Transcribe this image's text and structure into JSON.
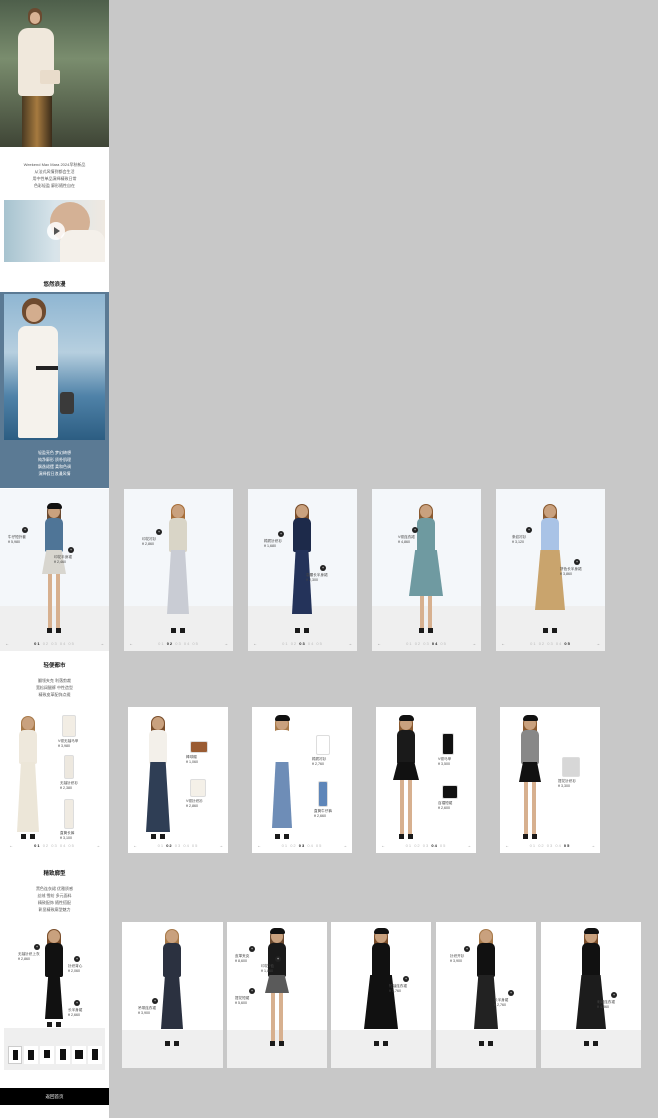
{
  "intro_lines": [
    "Weekend Max Mara 2024早秋新品",
    "从法式风情到都会生活",
    "用中性单品演绎精致日常",
    "色彩轻盈 廓形随性自在"
  ],
  "section1": {
    "title": "悠然浪漫",
    "lines": [
      "轻盈亮色 梦幻绮想",
      "纯净廓形 质朴肌理",
      "飘逸裙摆 柔和色调",
      "演绎假日浪漫风情"
    ]
  },
  "section2": {
    "title": "轻便都市",
    "lines": [
      "翻领夹克 利落剪裁",
      "宽松阔腿裤 中性造型",
      "精致皮革配饰点缀",
      "打造城市生活新风格"
    ]
  },
  "section3": {
    "title": "精致廓型",
    "lines": [
      "黑色连衣裙 优雅质感",
      "丝绒 雪纺 多元面料",
      "精致配饰 随性搭配",
      "彰显精致廓型魅力"
    ]
  },
  "bottom_button": "返回首页",
  "carousel1": [
    {
      "labels": [
        {
          "name": "牛仔短外套",
          "price": "¥ 5,980"
        },
        {
          "name": "印花半身裙",
          "price": "¥ 2,460"
        }
      ],
      "pager": [
        "01",
        "02",
        "03",
        "04",
        "05"
      ],
      "active": 0
    },
    {
      "labels": [
        {
          "name": "印花衬衫",
          "price": "¥ 2,860"
        }
      ],
      "pager": [
        "01",
        "02",
        "03",
        "04",
        "05"
      ],
      "active": 1
    },
    {
      "labels": [
        {
          "name": "棉质针织衫",
          "price": "¥ 1,680"
        },
        {
          "name": "高腰长半身裙",
          "price": "¥ 2,300"
        }
      ],
      "pager": [
        "01",
        "02",
        "03",
        "04",
        "05"
      ],
      "active": 2
    },
    {
      "labels": [
        {
          "name": "V领连衣裙",
          "price": "¥ 4,860"
        }
      ],
      "pager": [
        "01",
        "02",
        "03",
        "04",
        "05"
      ],
      "active": 3
    },
    {
      "labels": [
        {
          "name": "条纹衬衫",
          "price": "¥ 3,120"
        },
        {
          "name": "拼色长半身裙",
          "price": "¥ 3,860"
        }
      ],
      "pager": [
        "01",
        "02",
        "03",
        "04",
        "05"
      ],
      "active": 4
    }
  ],
  "carousel2": [
    {
      "items": [
        {
          "name": "V领无袖马甲",
          "price": "¥ 3,980"
        },
        {
          "name": "无袖针织衫",
          "price": "¥ 2,380"
        },
        {
          "name": "直筒长裤",
          "price": "¥ 3,100"
        }
      ],
      "pager": [
        "01",
        "02",
        "03",
        "04",
        "05"
      ],
      "active": 0
    },
    {
      "items": [
        {
          "name": "棒球帽",
          "price": "¥ 1,060"
        },
        {
          "name": "V领针织衫",
          "price": "¥ 2,860"
        }
      ],
      "pager": [
        "01",
        "02",
        "03",
        "04",
        "05"
      ],
      "active": 1
    },
    {
      "items": [
        {
          "name": "棉质衬衫",
          "price": "¥ 2,760"
        },
        {
          "name": "直筒牛仔裤",
          "price": "¥ 2,660"
        }
      ],
      "pager": [
        "01",
        "02",
        "03",
        "04",
        "05"
      ],
      "active": 2
    },
    {
      "items": [
        {
          "name": "V领马甲",
          "price": "¥ 3,500"
        },
        {
          "name": "百褶短裙",
          "price": "¥ 2,600"
        }
      ],
      "pager": [
        "01",
        "02",
        "03",
        "04",
        "05"
      ],
      "active": 3
    },
    {
      "items": [
        {
          "name": "提花针织衫",
          "price": "¥ 3,300"
        }
      ],
      "pager": [
        "01",
        "02",
        "03",
        "04",
        "05"
      ],
      "active": 4
    }
  ],
  "section3_card": {
    "labels": [
      {
        "name": "无袖针织上衣",
        "price": "¥ 2,860"
      },
      {
        "name": "针织背心",
        "price": "¥ 2,060"
      },
      {
        "name": "长半身裙",
        "price": "¥ 2,660"
      }
    ]
  },
  "carousel3": [
    {
      "labels": [
        {
          "name": "吊带连衣裙",
          "price": "¥ 3,900"
        }
      ]
    },
    {
      "labels": [
        {
          "name": "皮革夹克",
          "price": "¥ 8,600"
        },
        {
          "name": "印花T恤",
          "price": "¥ 1,860"
        },
        {
          "name": "提花短裙",
          "price": "¥ 5,600"
        }
      ]
    },
    {
      "labels": [
        {
          "name": "短袖连衣裙",
          "price": "¥ 3,760"
        }
      ]
    },
    {
      "labels": [
        {
          "name": "针织开衫",
          "price": "¥ 3,900"
        },
        {
          "name": "长半身裙",
          "price": "¥ 2,760"
        }
      ]
    },
    {
      "labels": [
        {
          "name": "刺绣连衣裙",
          "price": "¥ 4,860"
        }
      ]
    }
  ],
  "colors": {
    "accent": "#222222",
    "section_bg": "#f3f6f8",
    "gray_bg": "#c8c8c8",
    "blue_banner": "#5b7a94"
  }
}
